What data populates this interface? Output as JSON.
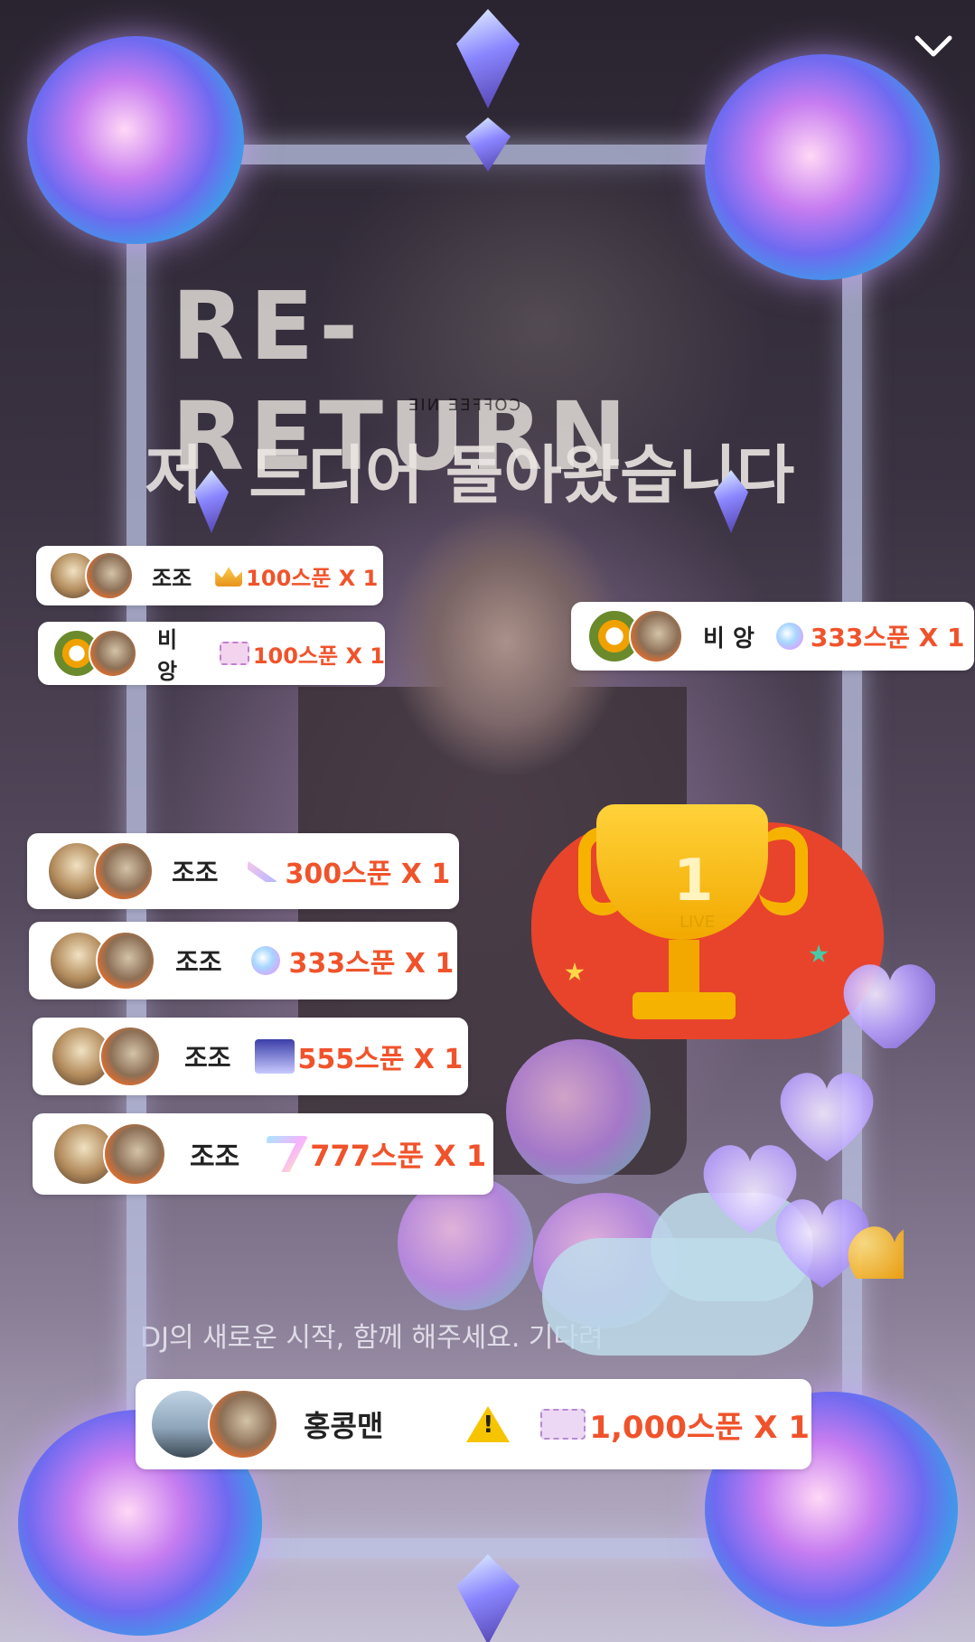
{
  "background": {
    "sign_main": "RE-RETURN",
    "sign_sub": "저, 드디어 돌아왔습니다",
    "sign_coffee": "COFFEE NIE",
    "caption": "DJ의 새로운 시작, 함께 해주세요. 기다려",
    "trophy_number": "1",
    "trophy_text": "LIVE"
  },
  "gifts": [
    {
      "name": "조조",
      "icon": "crown-icon",
      "amount": "100스푼 X 1"
    },
    {
      "name": "비 앙",
      "icon": "ticket-icon",
      "amount": "100스푼 X 1"
    },
    {
      "name": "비 앙",
      "icon": "orb-icon",
      "amount": "333스푼 X 1"
    },
    {
      "name": "조조",
      "icon": "feather-icon",
      "amount": "300스푼 X 1"
    },
    {
      "name": "조조",
      "icon": "orb-icon",
      "amount": "333스푼 X 1"
    },
    {
      "name": "조조",
      "icon": "stage-icon",
      "amount": "555스푼 X 1"
    },
    {
      "name": "조조",
      "icon": "lucky7-icon",
      "amount": "777스푼 X 1"
    },
    {
      "name": "홍콩맨",
      "icon": "ticket-icon",
      "amount": "1,000스푼 X 1",
      "warning": "!"
    }
  ],
  "colors": {
    "amount": "#f0532b",
    "chip_bg": "#ffffff",
    "trophy": "#f5b300",
    "trophy_blob": "#e8442b"
  }
}
